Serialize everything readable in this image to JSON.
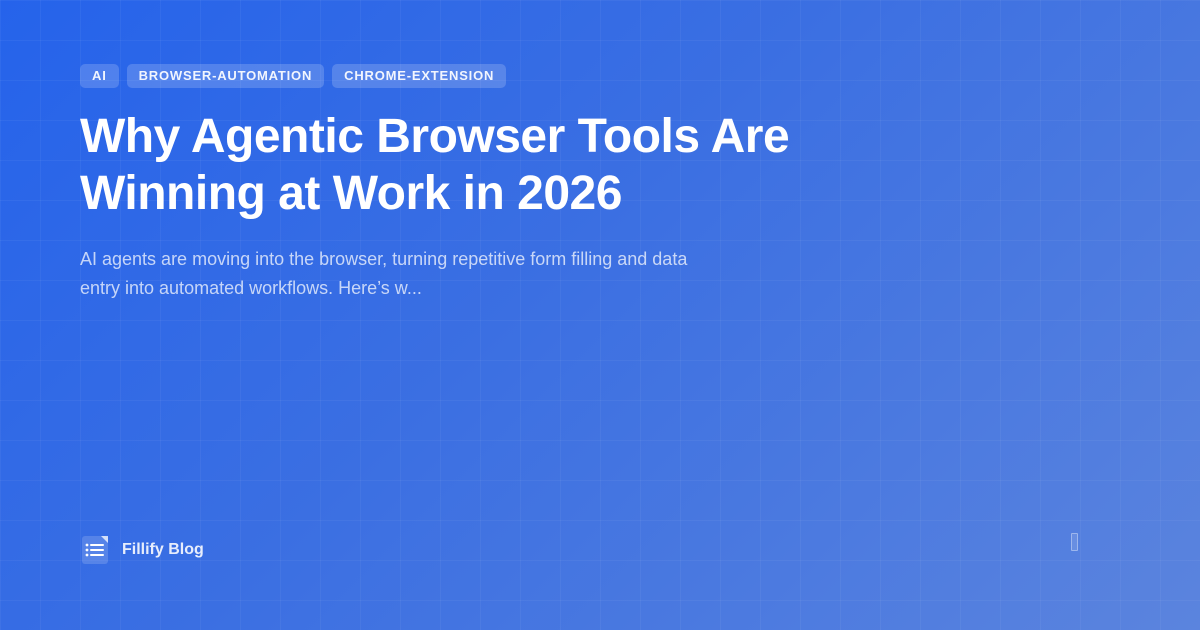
{
  "tags": [
    "AI",
    "BROWSER-AUTOMATION",
    "CHROME-EXTENSION"
  ],
  "title": "Why Agentic Browser Tools Are Winning at Work in 2026",
  "excerpt": "AI agents are moving into the browser, turning repetitive form filling and data entry into automated workflows. Here’s w...",
  "brand": {
    "name": "Fillify Blog",
    "icon": "document-list-icon"
  },
  "colors": {
    "background_start": "#2563eb",
    "background_end": "#5b84de",
    "text": "#ffffff"
  }
}
